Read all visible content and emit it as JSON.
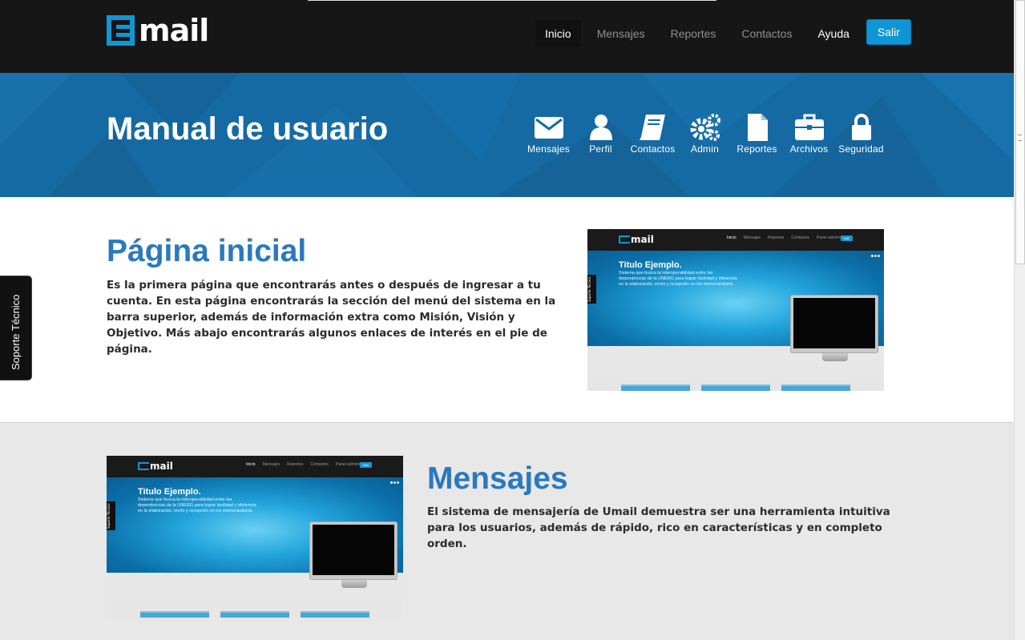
{
  "brand": {
    "name": "mail",
    "accent": "#1196d5"
  },
  "nav": {
    "items": [
      {
        "label": "Inicio",
        "state": "active"
      },
      {
        "label": "Mensajes",
        "state": "normal"
      },
      {
        "label": "Reportes",
        "state": "normal"
      },
      {
        "label": "Contactos",
        "state": "normal"
      },
      {
        "label": "Ayuda",
        "state": "highlight"
      }
    ],
    "logout": "Salir"
  },
  "hero": {
    "title": "Manual de usuario",
    "background": "#166aa3",
    "shortcuts": [
      {
        "label": "Mensajes",
        "icon": "envelope-icon"
      },
      {
        "label": "Perfil",
        "icon": "user-icon"
      },
      {
        "label": "Contactos",
        "icon": "book-icon"
      },
      {
        "label": "Admin",
        "icon": "gears-icon"
      },
      {
        "label": "Reportes",
        "icon": "file-icon"
      },
      {
        "label": "Archivos",
        "icon": "briefcase-icon"
      },
      {
        "label": "Seguridad",
        "icon": "lock-icon"
      }
    ]
  },
  "sections": [
    {
      "title": "Página inicial",
      "text": "Es la primera página que encontrarás antes o después de ingresar a tu cuenta. En esta página encontrarás la sección del menú del sistema en la barra superior, además de información extra como Misión, Visión y Objetivo. Más abajo encontrarás algunos enlaces de interés en el pie de página."
    },
    {
      "title": "Mensajes",
      "text": "El sistema de mensajería de Umail demuestra ser una herramienta intuitiva para los usuarios, además de rápido, rico en características y en completo orden."
    }
  ],
  "thumbnail": {
    "logo": "mail",
    "menu": [
      "Inicio",
      "Mensajes",
      "Reportes",
      "Contactos",
      "Panel administrativo"
    ],
    "button": "Salir",
    "heading": "Titulo Ejemplo.",
    "description": "Sistema que busca la interoperabilidad entre las dependencias de la UNERG para lograr facilidad y eficiencia en la elaboración, envío y recepción en los memorándums.",
    "side_tab": "Soporte Técnico"
  },
  "support_tab": "Soporte Técnico"
}
